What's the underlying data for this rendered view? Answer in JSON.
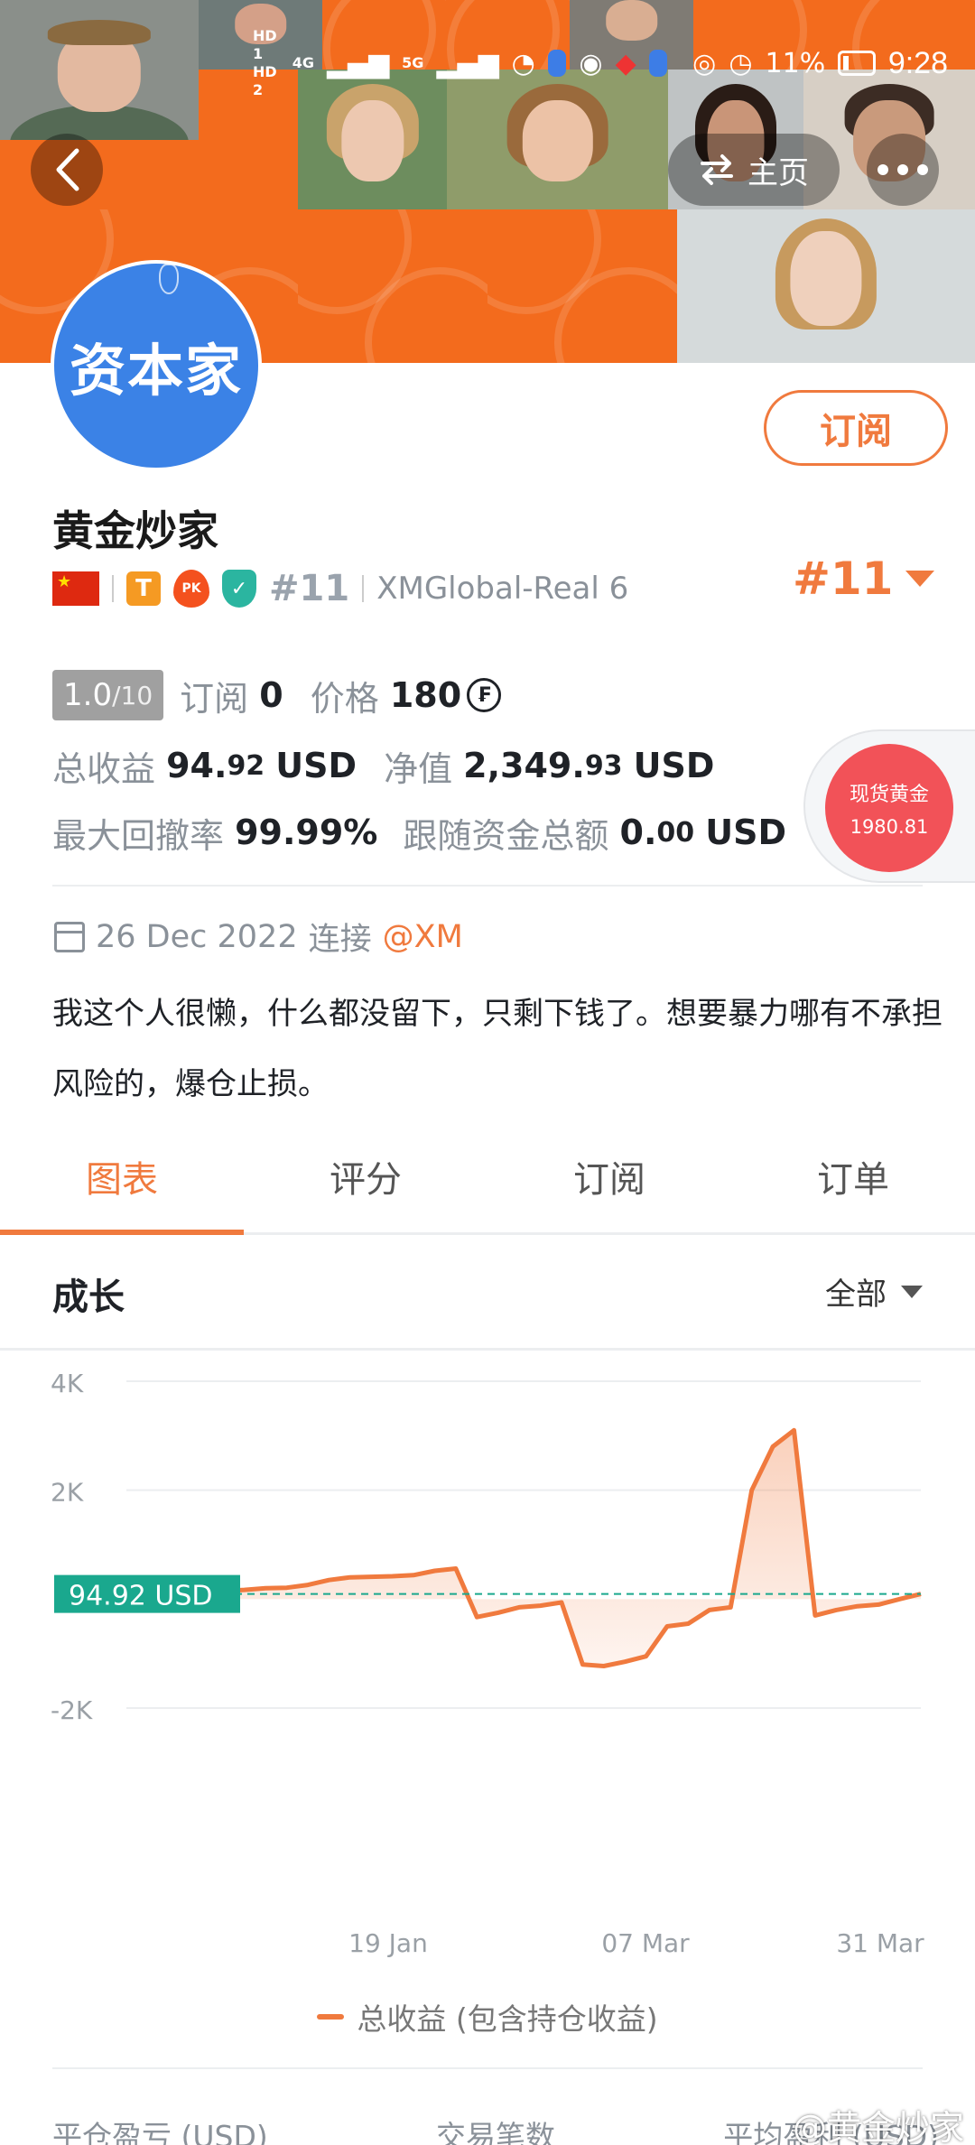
{
  "status_bar": {
    "hd1": "HD 1",
    "hd2": "HD 2",
    "net1": "4G",
    "net2": "5G",
    "battery": "11%",
    "time": "9:28"
  },
  "header": {
    "home_label": "主页"
  },
  "profile": {
    "avatar_text": "资本家",
    "name": "黄金炒家",
    "subscribe_label": "订阅",
    "badge_t": "T",
    "badge_pk": "PK",
    "rank_small": "#11",
    "server": "XMGlobal-Real 6",
    "rank_big": "#11"
  },
  "stats": {
    "score": "1.0",
    "score_max": "/10",
    "subscriptions_label": "订阅",
    "subscriptions_value": "0",
    "price_label": "价格",
    "price_value": "180",
    "total_profit_label": "总收益",
    "total_profit_int": "94.",
    "total_profit_dec": "92",
    "total_profit_unit": "USD",
    "equity_label": "净值",
    "equity_int": "2,349.",
    "equity_dec": "93",
    "equity_unit": "USD",
    "max_drawdown_label": "最大回撤率",
    "max_drawdown_value": "99.99%",
    "follow_funds_label": "跟随资金总额",
    "follow_funds_int": "0.",
    "follow_funds_dec": "00",
    "follow_funds_unit": "USD"
  },
  "gold_widget": {
    "label": "现货黄金",
    "price": "1980.81"
  },
  "connection": {
    "date": "26 Dec 2022",
    "connect_label": "连接",
    "broker": "@XM"
  },
  "bio": "我这个人很懒，什么都没留下，只剩下钱了。想要暴力哪有不承担风险的，爆仓止损。",
  "tabs": [
    {
      "label": "图表"
    },
    {
      "label": "评分"
    },
    {
      "label": "订阅"
    },
    {
      "label": "订单"
    }
  ],
  "section": {
    "title": "成长",
    "range": "全部"
  },
  "chart_data": {
    "type": "area",
    "x_tick_labels": [
      "19 Jan",
      "07 Mar",
      "31 Mar"
    ],
    "y_ticks": [
      4000,
      2000,
      -2000
    ],
    "y_tick_labels": [
      "4K",
      "2K",
      "-2K"
    ],
    "ylim": [
      -2000,
      4000
    ],
    "current_value_label": "94.92 USD",
    "current_value": 94.92,
    "series": [
      {
        "name": "总收益 (包含持仓收益)",
        "color": "#f07a3e",
        "values": [
          300,
          290,
          270,
          250,
          240,
          270,
          210,
          180,
          150,
          170,
          200,
          210,
          260,
          350,
          400,
          410,
          420,
          440,
          520,
          560,
          -330,
          -250,
          -150,
          -120,
          -60,
          -1200,
          -1230,
          -1150,
          -1050,
          -500,
          -450,
          -200,
          -150,
          2000,
          2800,
          3100,
          -300,
          -200,
          -130,
          -100,
          0,
          94.92
        ]
      }
    ]
  },
  "legend": {
    "label": "总收益 (包含持仓收益)"
  },
  "summary": {
    "col1": "平仓盈亏 (USD)",
    "col2": "交易笔数",
    "col3": "平均盈利 (USD)"
  },
  "watermark": "@黄金炒家"
}
